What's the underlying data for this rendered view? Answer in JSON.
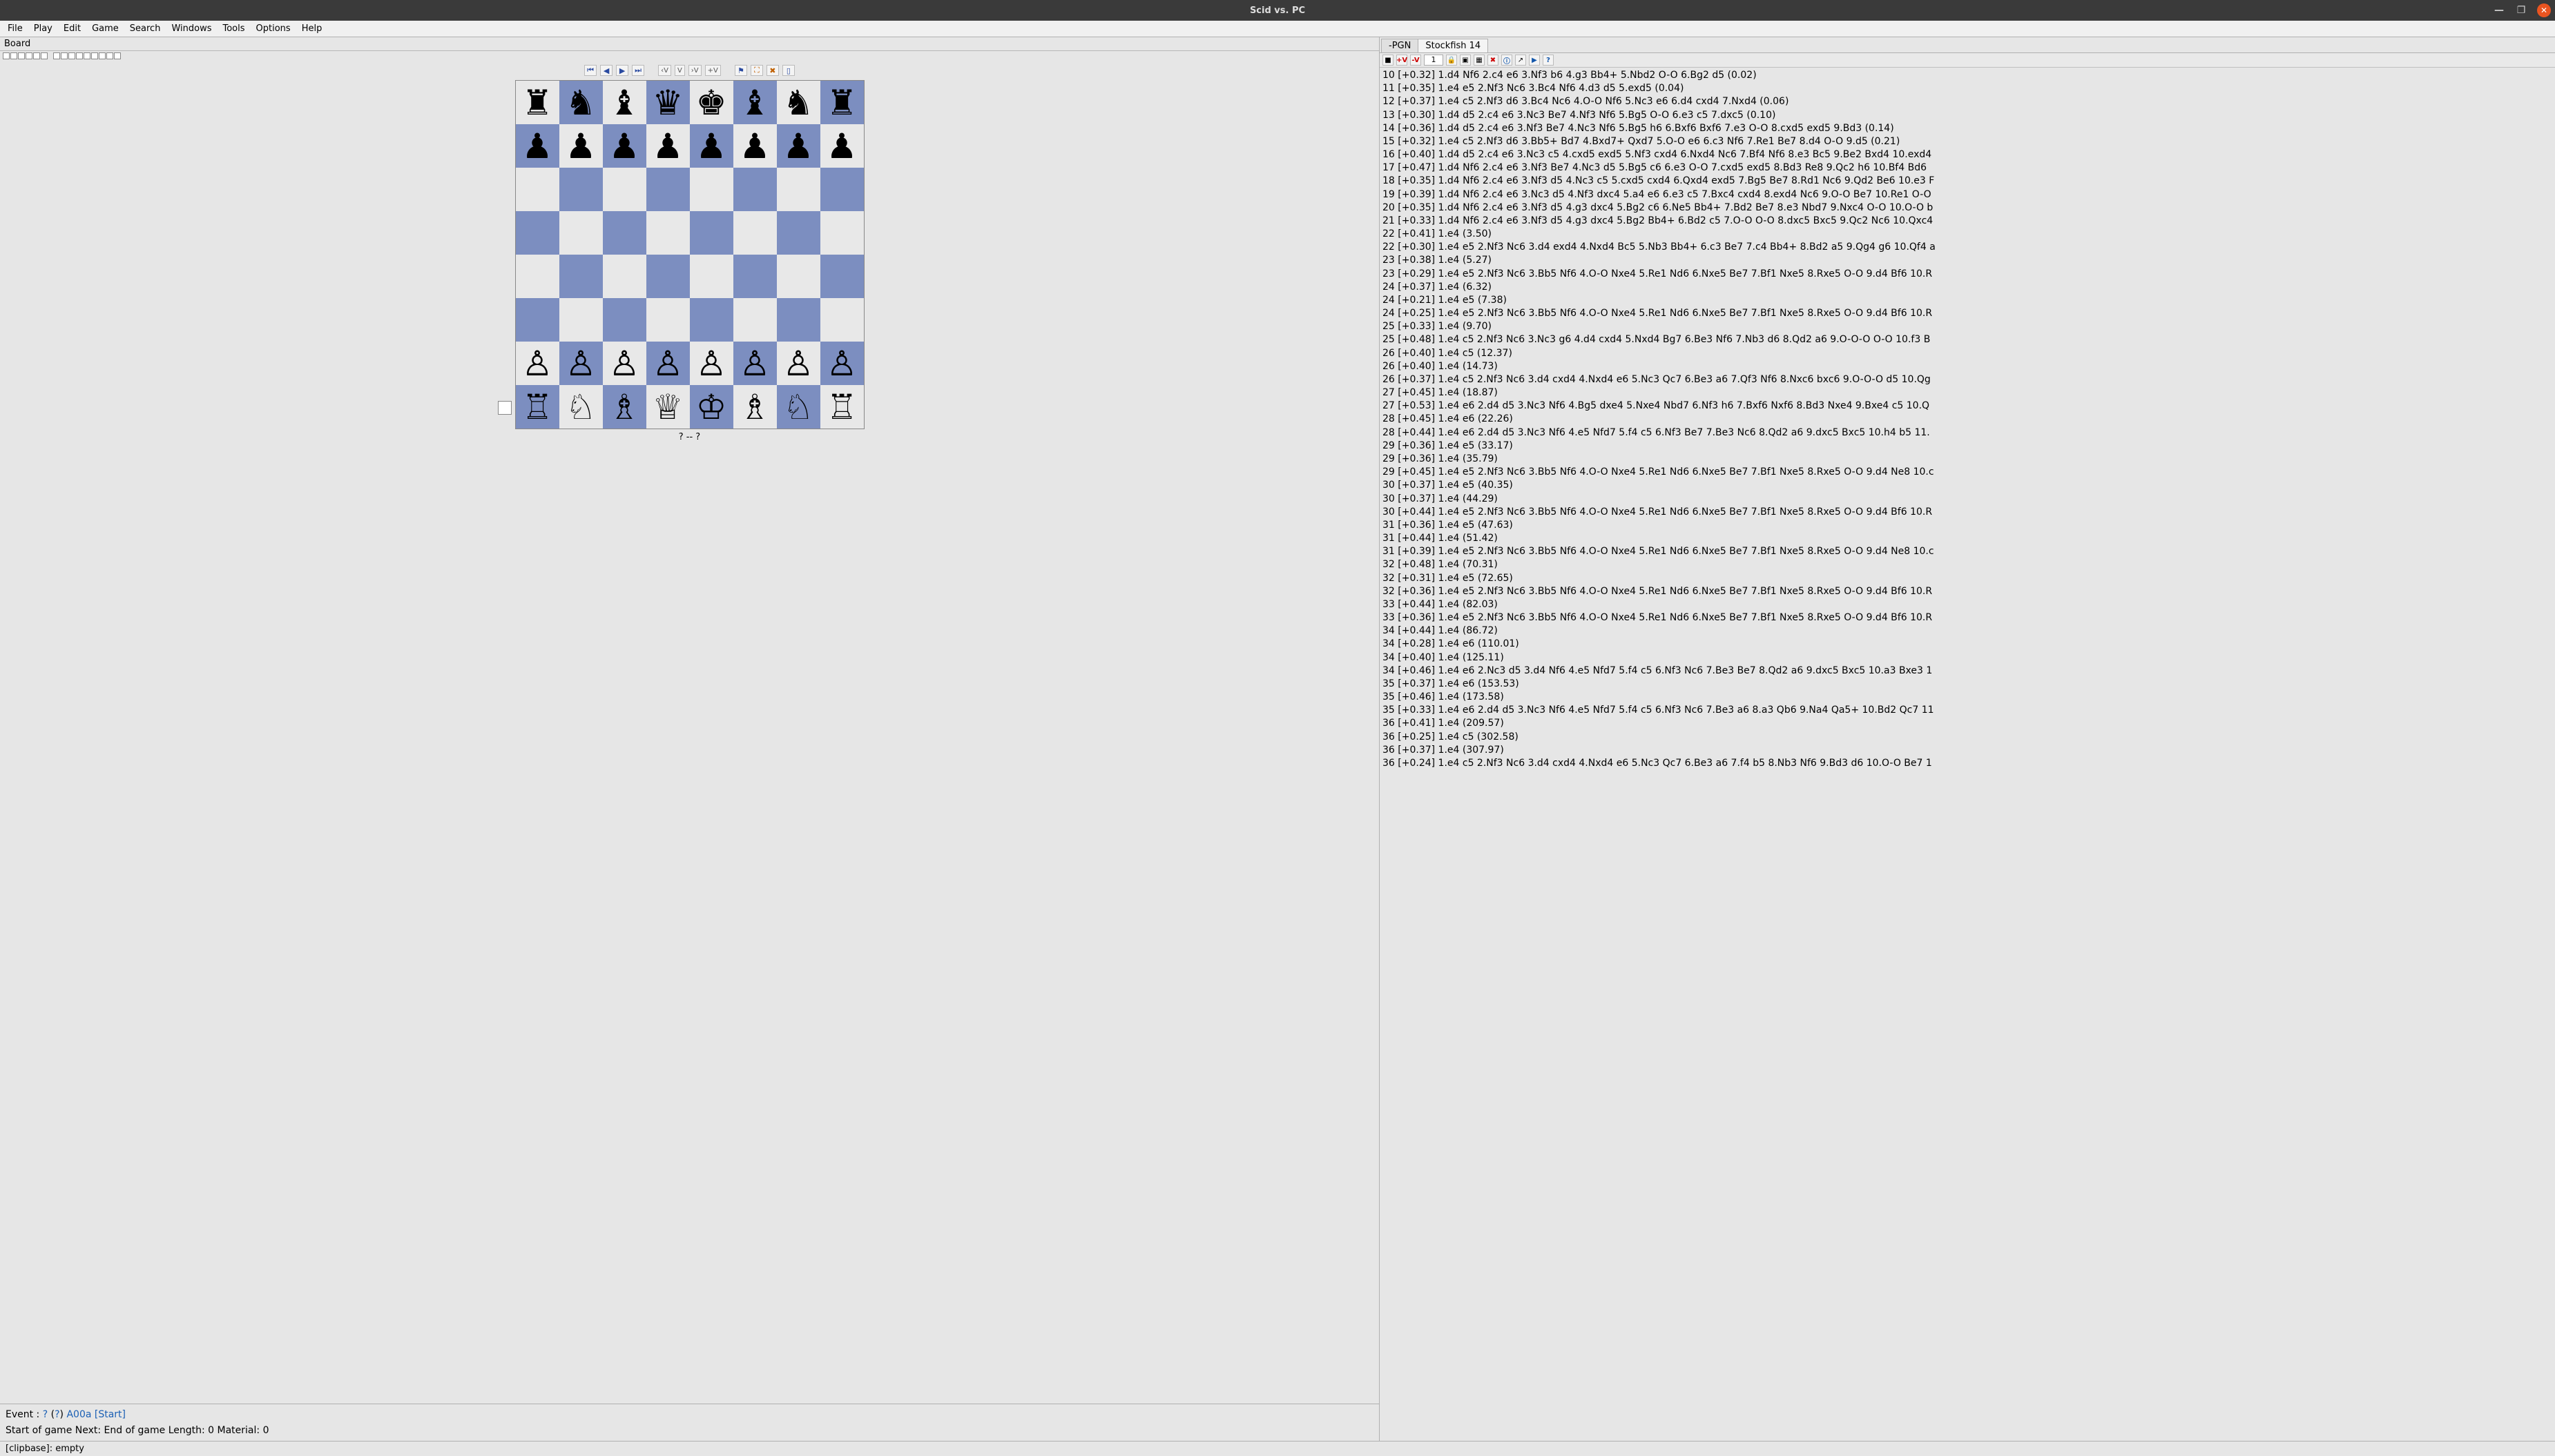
{
  "window": {
    "title": "Scid vs. PC"
  },
  "menu": [
    "File",
    "Play",
    "Edit",
    "Game",
    "Search",
    "Windows",
    "Tools",
    "Options",
    "Help"
  ],
  "left_label": "Board",
  "nav_labels": {
    "first": "⏮",
    "prev": "◀",
    "next": "▶",
    "last": "⏭",
    "varminus": "‹V",
    "varV": "V",
    "varplus": "›V",
    "varadd": "+V",
    "flag": "⚑",
    "tree": "⛶",
    "exit": "✖",
    "cpy": "▯"
  },
  "board": {
    "r8": [
      "♜",
      "♞",
      "♝",
      "♛",
      "♚",
      "♝",
      "♞",
      "♜"
    ],
    "r7": [
      "♟",
      "♟",
      "♟",
      "♟",
      "♟",
      "♟",
      "♟",
      "♟"
    ],
    "r2": [
      "♙",
      "♙",
      "♙",
      "♙",
      "♙",
      "♙",
      "♙",
      "♙"
    ],
    "r1": [
      "♖",
      "♘",
      "♗",
      "♕",
      "♔",
      "♗",
      "♘",
      "♖"
    ]
  },
  "below_board": "?    --    ?",
  "game_info": {
    "line1_pre": "Event : ",
    "q1": "?",
    "par_open": "  (",
    "q2": "?",
    "par_close": ")  ",
    "eco": "A00a [Start]",
    "line2": "Start of game          Next:  End of game   Length: 0        Material: 0"
  },
  "tabs": {
    "t1": "-PGN",
    "t2": "Stockfish 14"
  },
  "engine_toolbar": {
    "spin": "1",
    "stop": "■",
    "plus": "+V",
    "minus": "-V",
    "lock": "🔒",
    "cpu": "▣",
    "g": "▦",
    "x": "✖",
    "i": "ⓘ",
    "a": "↗",
    "p": "▶",
    "h": "?"
  },
  "analysis": [
    "10 [+0.32]  1.d4 Nf6 2.c4 e6 3.Nf3 b6 4.g3 Bb4+ 5.Nbd2 O-O 6.Bg2 d5  (0.02)",
    "11 [+0.35]  1.e4 e5 2.Nf3 Nc6 3.Bc4 Nf6 4.d3 d5 5.exd5  (0.04)",
    "12 [+0.37]  1.e4 c5 2.Nf3 d6 3.Bc4 Nc6 4.O-O Nf6 5.Nc3 e6 6.d4 cxd4 7.Nxd4  (0.06)",
    "13 [+0.30]  1.d4 d5 2.c4 e6 3.Nc3 Be7 4.Nf3 Nf6 5.Bg5 O-O 6.e3 c5 7.dxc5  (0.10)",
    "14 [+0.36]  1.d4 d5 2.c4 e6 3.Nf3 Be7 4.Nc3 Nf6 5.Bg5 h6 6.Bxf6 Bxf6 7.e3 O-O 8.cxd5 exd5 9.Bd3  (0.14)",
    "15 [+0.32]  1.e4 c5 2.Nf3 d6 3.Bb5+ Bd7 4.Bxd7+ Qxd7 5.O-O e6 6.c3 Nf6 7.Re1 Be7 8.d4 O-O 9.d5  (0.21)",
    "16 [+0.40]  1.d4 d5 2.c4 e6 3.Nc3 c5 4.cxd5 exd5 5.Nf3 cxd4 6.Nxd4 Nc6 7.Bf4 Nf6 8.e3 Bc5 9.Be2 Bxd4 10.exd4",
    "17 [+0.47]  1.d4 Nf6 2.c4 e6 3.Nf3 Be7 4.Nc3 d5 5.Bg5 c6 6.e3 O-O 7.cxd5 exd5 8.Bd3 Re8 9.Qc2 h6 10.Bf4 Bd6",
    "18 [+0.35]  1.d4 Nf6 2.c4 e6 3.Nf3 d5 4.Nc3 c5 5.cxd5 cxd4 6.Qxd4 exd5 7.Bg5 Be7 8.Rd1 Nc6 9.Qd2 Be6 10.e3 F",
    "19 [+0.39]  1.d4 Nf6 2.c4 e6 3.Nc3 d5 4.Nf3 dxc4 5.a4 e6 6.e3 c5 7.Bxc4 cxd4 8.exd4 Nc6 9.O-O Be7 10.Re1 O-O",
    "20 [+0.35]  1.d4 Nf6 2.c4 e6 3.Nf3 d5 4.g3 dxc4 5.Bg2 c6 6.Ne5 Bb4+ 7.Bd2 Be7 8.e3 Nbd7 9.Nxc4 O-O 10.O-O b",
    "21 [+0.33]  1.d4 Nf6 2.c4 e6 3.Nf3 d5 4.g3 dxc4 5.Bg2 Bb4+ 6.Bd2 c5 7.O-O O-O 8.dxc5 Bxc5 9.Qc2 Nc6 10.Qxc4",
    "22 [+0.41]  1.e4  (3.50)",
    "22 [+0.30]  1.e4 e5 2.Nf3 Nc6 3.d4 exd4 4.Nxd4 Bc5 5.Nb3 Bb4+ 6.c3 Be7 7.c4 Bb4+ 8.Bd2 a5 9.Qg4 g6 10.Qf4 a",
    "23 [+0.38]  1.e4  (5.27)",
    "23 [+0.29]  1.e4 e5 2.Nf3 Nc6 3.Bb5 Nf6 4.O-O Nxe4 5.Re1 Nd6 6.Nxe5 Be7 7.Bf1 Nxe5 8.Rxe5 O-O 9.d4 Bf6 10.R",
    "24 [+0.37]  1.e4  (6.32)",
    "24 [+0.21]  1.e4 e5  (7.38)",
    "24 [+0.25]  1.e4 e5 2.Nf3 Nc6 3.Bb5 Nf6 4.O-O Nxe4 5.Re1 Nd6 6.Nxe5 Be7 7.Bf1 Nxe5 8.Rxe5 O-O 9.d4 Bf6 10.R",
    "25 [+0.33]  1.e4  (9.70)",
    "25 [+0.48]  1.e4 c5 2.Nf3 Nc6 3.Nc3 g6 4.d4 cxd4 5.Nxd4 Bg7 6.Be3 Nf6 7.Nb3 d6 8.Qd2 a6 9.O-O-O O-O 10.f3 B",
    "26 [+0.40]  1.e4 c5  (12.37)",
    "26 [+0.40]  1.e4  (14.73)",
    "26 [+0.37]  1.e4 c5 2.Nf3 Nc6 3.d4 cxd4 4.Nxd4 e6 5.Nc3 Qc7 6.Be3 a6 7.Qf3 Nf6 8.Nxc6 bxc6 9.O-O-O d5 10.Qg",
    "27 [+0.45]  1.e4  (18.87)",
    "27 [+0.53]  1.e4 e6 2.d4 d5 3.Nc3 Nf6 4.Bg5 dxe4 5.Nxe4 Nbd7 6.Nf3 h6 7.Bxf6 Nxf6 8.Bd3 Nxe4 9.Bxe4 c5 10.Q",
    "28 [+0.45]  1.e4 e6  (22.26)",
    "28 [+0.44]  1.e4 e6 2.d4 d5 3.Nc3 Nf6 4.e5 Nfd7 5.f4 c5 6.Nf3 Be7 7.Be3 Nc6 8.Qd2 a6 9.dxc5 Bxc5 10.h4 b5 11.",
    "29 [+0.36]  1.e4 e5  (33.17)",
    "29 [+0.36]  1.e4  (35.79)",
    "29 [+0.45]  1.e4 e5 2.Nf3 Nc6 3.Bb5 Nf6 4.O-O Nxe4 5.Re1 Nd6 6.Nxe5 Be7 7.Bf1 Nxe5 8.Rxe5 O-O 9.d4 Ne8 10.c",
    "30 [+0.37]  1.e4 e5  (40.35)",
    "30 [+0.37]  1.e4  (44.29)",
    "30 [+0.44]  1.e4 e5 2.Nf3 Nc6 3.Bb5 Nf6 4.O-O Nxe4 5.Re1 Nd6 6.Nxe5 Be7 7.Bf1 Nxe5 8.Rxe5 O-O 9.d4 Bf6 10.R",
    "31 [+0.36]  1.e4 e5  (47.63)",
    "31 [+0.44]  1.e4  (51.42)",
    "31 [+0.39]  1.e4 e5 2.Nf3 Nc6 3.Bb5 Nf6 4.O-O Nxe4 5.Re1 Nd6 6.Nxe5 Be7 7.Bf1 Nxe5 8.Rxe5 O-O 9.d4 Ne8 10.c",
    "32 [+0.48]  1.e4  (70.31)",
    "32 [+0.31]  1.e4 e5  (72.65)",
    "32 [+0.36]  1.e4 e5 2.Nf3 Nc6 3.Bb5 Nf6 4.O-O Nxe4 5.Re1 Nd6 6.Nxe5 Be7 7.Bf1 Nxe5 8.Rxe5 O-O 9.d4 Bf6 10.R",
    "33 [+0.44]  1.e4  (82.03)",
    "33 [+0.36]  1.e4 e5 2.Nf3 Nc6 3.Bb5 Nf6 4.O-O Nxe4 5.Re1 Nd6 6.Nxe5 Be7 7.Bf1 Nxe5 8.Rxe5 O-O 9.d4 Bf6 10.R",
    "34 [+0.44]  1.e4  (86.72)",
    "34 [+0.28]  1.e4 e6  (110.01)",
    "34 [+0.40]  1.e4  (125.11)",
    "34 [+0.46]  1.e4 e6 2.Nc3 d5 3.d4 Nf6 4.e5 Nfd7 5.f4 c5 6.Nf3 Nc6 7.Be3 Be7 8.Qd2 a6 9.dxc5 Bxc5 10.a3 Bxe3 1",
    "35 [+0.37]  1.e4 e6  (153.53)",
    "35 [+0.46]  1.e4  (173.58)",
    "35 [+0.33]  1.e4 e6 2.d4 d5 3.Nc3 Nf6 4.e5 Nfd7 5.f4 c5 6.Nf3 Nc6 7.Be3 a6 8.a3 Qb6 9.Na4 Qa5+ 10.Bd2 Qc7 11",
    "36 [+0.41]  1.e4  (209.57)",
    "36 [+0.25]  1.e4 c5  (302.58)",
    "36 [+0.37]  1.e4  (307.97)",
    "36 [+0.24]  1.e4 c5 2.Nf3 Nc6 3.d4 cxd4 4.Nxd4 e6 5.Nc3 Qc7 6.Be3 a6 7.f4 b5 8.Nb3 Nf6 9.Bd3 d6 10.O-O Be7 1"
  ],
  "status": "[clipbase]:  empty"
}
